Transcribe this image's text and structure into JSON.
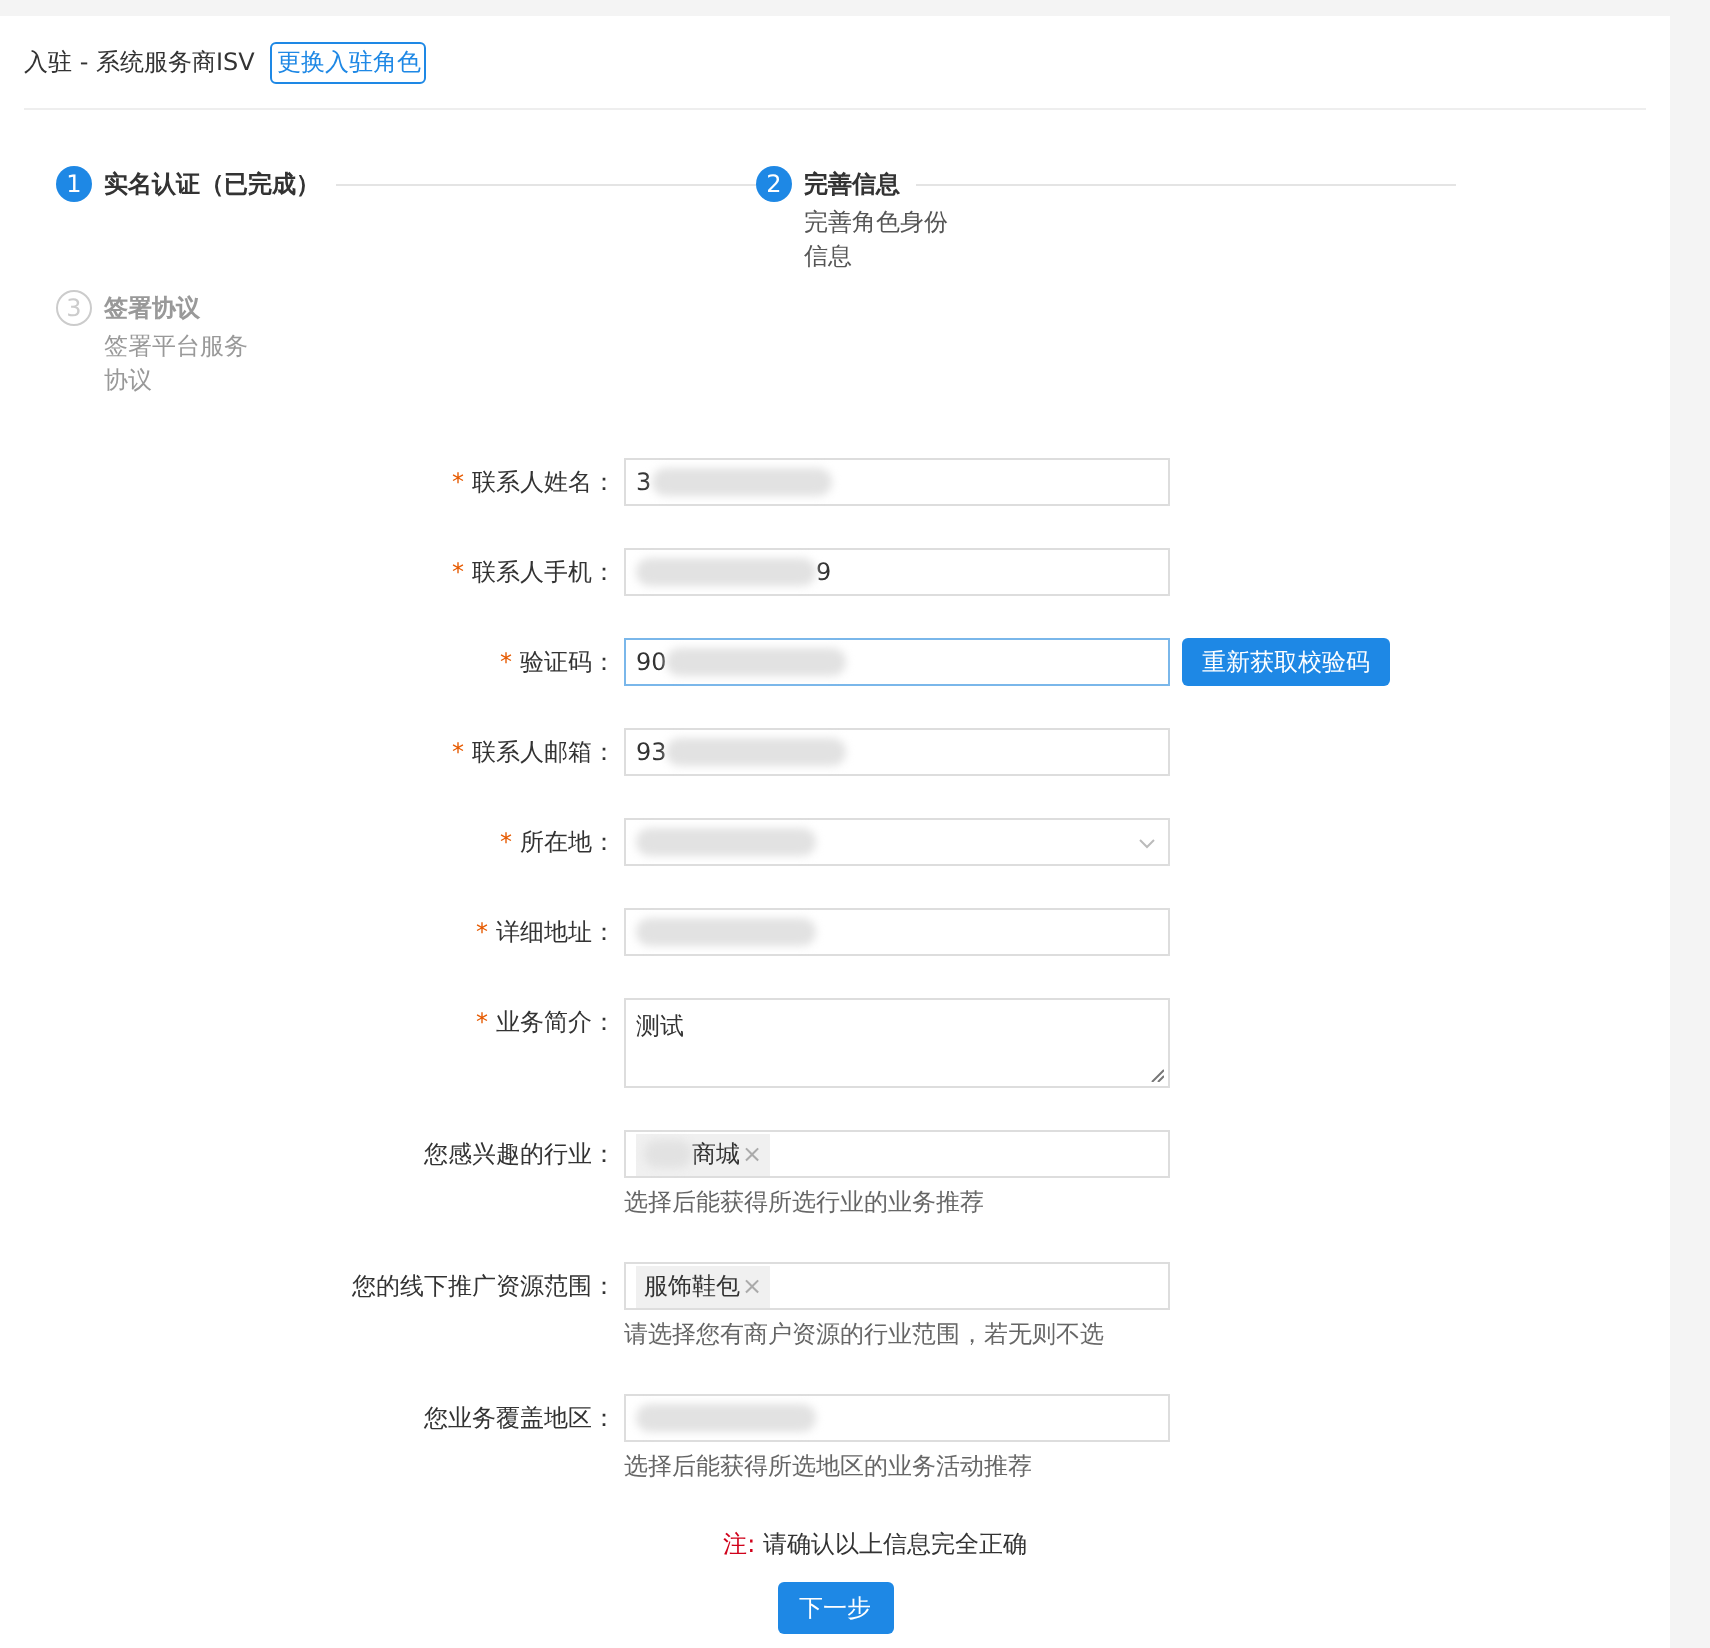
{
  "header": {
    "title": "入驻 - 系统服务商ISV",
    "link": "更换入驻角色"
  },
  "steps": [
    {
      "number": "1",
      "title": "实名认证（已完成）",
      "disabled": false
    },
    {
      "number": "2",
      "title": "完善信息",
      "description": "完善角色身份信息",
      "disabled": false
    },
    {
      "number": "3",
      "title": "签署协议",
      "description": "签署平台服务协议",
      "disabled": true
    }
  ],
  "form": [
    {
      "label": "联系人姓名：",
      "required_mark": "*",
      "kind": "input",
      "focused": false,
      "value": [
        {
          "kind": "text",
          "text": "3"
        },
        {
          "kind": "blur"
        }
      ]
    },
    {
      "label": "联系人手机：",
      "required_mark": "*",
      "kind": "input",
      "focused": false,
      "value": [
        {
          "kind": "blur"
        },
        {
          "kind": "text",
          "text": "9"
        }
      ]
    },
    {
      "label": "验证码：",
      "required_mark": "*",
      "kind": "input",
      "focused": true,
      "value": [
        {
          "kind": "text",
          "text": "90"
        },
        {
          "kind": "blur"
        }
      ],
      "button": "重新获取校验码"
    },
    {
      "label": "联系人邮箱：",
      "required_mark": "*",
      "kind": "input",
      "focused": false,
      "value": [
        {
          "kind": "text",
          "text": "93"
        },
        {
          "kind": "blur"
        }
      ]
    },
    {
      "label": "所在地：",
      "required_mark": "*",
      "kind": "select",
      "focused": false,
      "value": [
        {
          "kind": "blur"
        }
      ]
    },
    {
      "label": "详细地址：",
      "required_mark": "*",
      "kind": "input",
      "focused": false,
      "value": [
        {
          "kind": "blur"
        }
      ]
    },
    {
      "label": "业务简介：",
      "required_mark": "*",
      "kind": "textarea",
      "focused": false,
      "value": [
        {
          "kind": "text",
          "text": "测试"
        }
      ]
    },
    {
      "label": "您感兴趣的行业：",
      "kind": "tags",
      "focused": false,
      "tags": [
        {
          "parts": [
            {
              "kind": "blur"
            },
            {
              "kind": "text",
              "text": "商城"
            }
          ],
          "remove": "×"
        }
      ],
      "hint": "选择后能获得所选行业的业务推荐"
    },
    {
      "label": "您的线下推广资源范围：",
      "kind": "tags",
      "focused": false,
      "tags": [
        {
          "parts": [
            {
              "kind": "text",
              "text": "服饰鞋包"
            }
          ],
          "remove": "×"
        }
      ],
      "hint": "请选择您有商户资源的行业范围，若无则不选"
    },
    {
      "label": "您业务覆盖地区：",
      "kind": "input",
      "focused": false,
      "value": [
        {
          "kind": "blur"
        }
      ],
      "hint": "选择后能获得所选地区的业务活动推荐"
    }
  ],
  "note": {
    "prefix": "注:",
    "text": "请确认以上信息完全正确"
  },
  "next_button": "下一步"
}
